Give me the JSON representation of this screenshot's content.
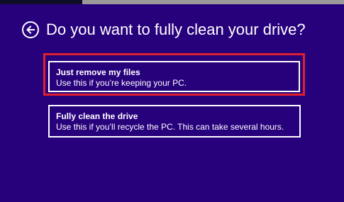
{
  "colors": {
    "background": "#27007c",
    "text": "#ffffff",
    "highlight_border": "#e0202e"
  },
  "header": {
    "back_icon": "back-arrow-circle-icon",
    "title": "Do you want to fully clean your drive?"
  },
  "options": [
    {
      "title": "Just remove my files",
      "description": "Use this if you’re keeping your PC."
    },
    {
      "title": "Fully clean the drive",
      "description": "Use this if you’ll recycle the PC. This can take several hours."
    }
  ]
}
